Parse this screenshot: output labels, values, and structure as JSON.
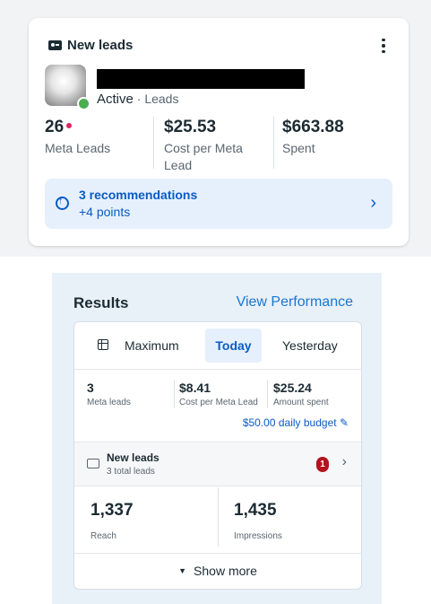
{
  "top_card": {
    "title": "New leads",
    "status": "Active",
    "separator": "·",
    "objective": "Leads",
    "metrics": [
      {
        "value": "26",
        "label": "Meta Leads"
      },
      {
        "value": "$25.53",
        "label": "Cost per Meta Lead"
      },
      {
        "value": "$663.88",
        "label": "Spent"
      }
    ],
    "recommendation": {
      "title": "3 recommendations",
      "subtitle": "+4 points",
      "chevron": "›"
    }
  },
  "results": {
    "title": "Results",
    "view_link": "View Performance",
    "tabs": [
      "Maximum",
      "Today",
      "Yesterday"
    ],
    "selected_tab": "Today",
    "metrics": [
      {
        "value": "3",
        "label": "Meta leads"
      },
      {
        "value": "$8.41",
        "label": "Cost per Meta Lead"
      },
      {
        "value": "$25.24",
        "label": "Amount spent"
      }
    ],
    "budget": "$50.00 daily budget",
    "budget_icon": "✎",
    "leads_row": {
      "title": "New leads",
      "subtitle": "3 total leads",
      "badge": "1",
      "chevron": "›"
    },
    "reach": {
      "value": "1,337",
      "label": "Reach"
    },
    "impressions": {
      "value": "1,435",
      "label": "Impressions"
    },
    "show_more": "Show more"
  },
  "colors": {
    "accent": "#1877d2",
    "link_blue": "#0a5bc4",
    "badge_red": "#b3141e",
    "status_green": "#4cae4f"
  }
}
